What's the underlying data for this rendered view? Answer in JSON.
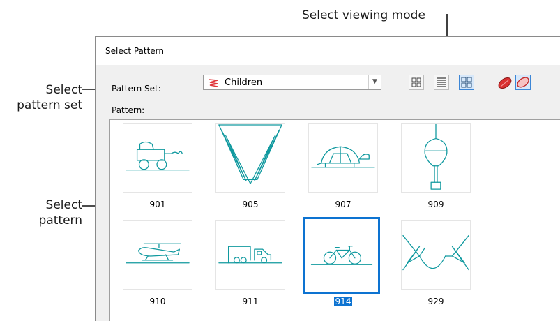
{
  "callouts": {
    "viewing_mode": "Select viewing mode",
    "pattern_set_line1": "Select",
    "pattern_set_line2": "pattern set",
    "pattern_line1": "Select",
    "pattern_line2": "pattern"
  },
  "dialog": {
    "title": "Select Pattern",
    "pattern_set_label": "Pattern Set:",
    "pattern_set_value": "Children",
    "pattern_label": "Pattern:"
  },
  "toolbar": {
    "icons": [
      "large-grid-icon",
      "list-view-icon",
      "small-grid-icon",
      "filled-shape-icon",
      "outline-shape-icon"
    ],
    "active_view": "small-grid-icon"
  },
  "patterns": [
    {
      "id": "901",
      "depicts": "baby-carriage"
    },
    {
      "id": "905",
      "depicts": "zigzag"
    },
    {
      "id": "907",
      "depicts": "turtle"
    },
    {
      "id": "909",
      "depicts": "hot-air-balloon"
    },
    {
      "id": "910",
      "depicts": "helicopter"
    },
    {
      "id": "911",
      "depicts": "truck"
    },
    {
      "id": "914",
      "depicts": "bicycle"
    },
    {
      "id": "929",
      "depicts": "bows"
    }
  ],
  "selected_pattern": "914",
  "colors": {
    "accent": "#0d73d1",
    "stitch": "#10999f",
    "dialog_bg": "#f0f0f0",
    "shape_red": "#d93030"
  }
}
